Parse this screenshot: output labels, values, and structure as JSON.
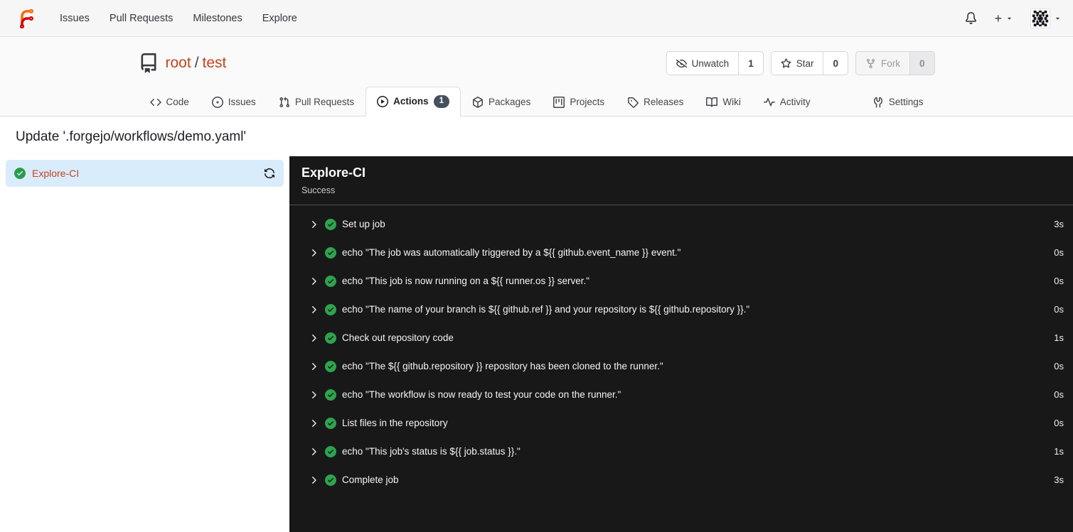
{
  "navbar": {
    "logo": "forgejo-logo",
    "items": [
      {
        "label": "Issues"
      },
      {
        "label": "Pull Requests"
      },
      {
        "label": "Milestones"
      },
      {
        "label": "Explore"
      }
    ],
    "plus_label": "+"
  },
  "repo": {
    "owner": "root",
    "separator": "/",
    "name": "test",
    "watch": {
      "label": "Unwatch",
      "count": "1"
    },
    "star": {
      "label": "Star",
      "count": "0"
    },
    "fork": {
      "label": "Fork",
      "count": "0",
      "disabled": true
    }
  },
  "tabs": [
    {
      "label": "Code",
      "icon": "code-icon"
    },
    {
      "label": "Issues",
      "icon": "issue-opened-icon"
    },
    {
      "label": "Pull Requests",
      "icon": "git-pull-request-icon"
    },
    {
      "label": "Actions",
      "icon": "play-circle-icon",
      "badge": "1",
      "active": true
    },
    {
      "label": "Packages",
      "icon": "package-icon"
    },
    {
      "label": "Projects",
      "icon": "project-board-icon"
    },
    {
      "label": "Releases",
      "icon": "tag-icon"
    },
    {
      "label": "Wiki",
      "icon": "book-open-icon"
    },
    {
      "label": "Activity",
      "icon": "pulse-icon"
    },
    {
      "label": "Settings",
      "icon": "tools-icon"
    }
  ],
  "page": {
    "title": "Update '.forgejo/workflows/demo.yaml'"
  },
  "jobs": [
    {
      "name": "Explore-CI",
      "status": "success"
    }
  ],
  "panel": {
    "title": "Explore-CI",
    "status": "Success",
    "steps": [
      {
        "name": "Set up job",
        "duration": "3s"
      },
      {
        "name": "echo \"The job was automatically triggered by a ${{ github.event_name }} event.\"",
        "duration": "0s"
      },
      {
        "name": "echo \"This job is now running on a ${{ runner.os }} server.\"",
        "duration": "0s"
      },
      {
        "name": "echo \"The name of your branch is ${{ github.ref }} and your repository is ${{ github.repository }}.\"",
        "duration": "0s"
      },
      {
        "name": "Check out repository code",
        "duration": "1s"
      },
      {
        "name": "echo \"The ${{ github.repository }} repository has been cloned to the runner.\"",
        "duration": "0s"
      },
      {
        "name": "echo \"The workflow is now ready to test your code on the runner.\"",
        "duration": "0s"
      },
      {
        "name": "List files in the repository",
        "duration": "0s"
      },
      {
        "name": "echo \"This job's status is ${{ job.status }}.\"",
        "duration": "1s"
      },
      {
        "name": "Complete job",
        "duration": "3s"
      }
    ]
  },
  "colors": {
    "accent_link": "#c5431f",
    "logo_orange": "#ff6600",
    "logo_red": "#d40000",
    "selected_job_bg": "#d9ecfb",
    "success_green": "#2da44e",
    "panel_bg": "#181818",
    "panel_border": "#4a5261",
    "badge_bg": "#45505e",
    "navbar_bg": "#f6f6f7",
    "header_bg": "#fafafa"
  }
}
